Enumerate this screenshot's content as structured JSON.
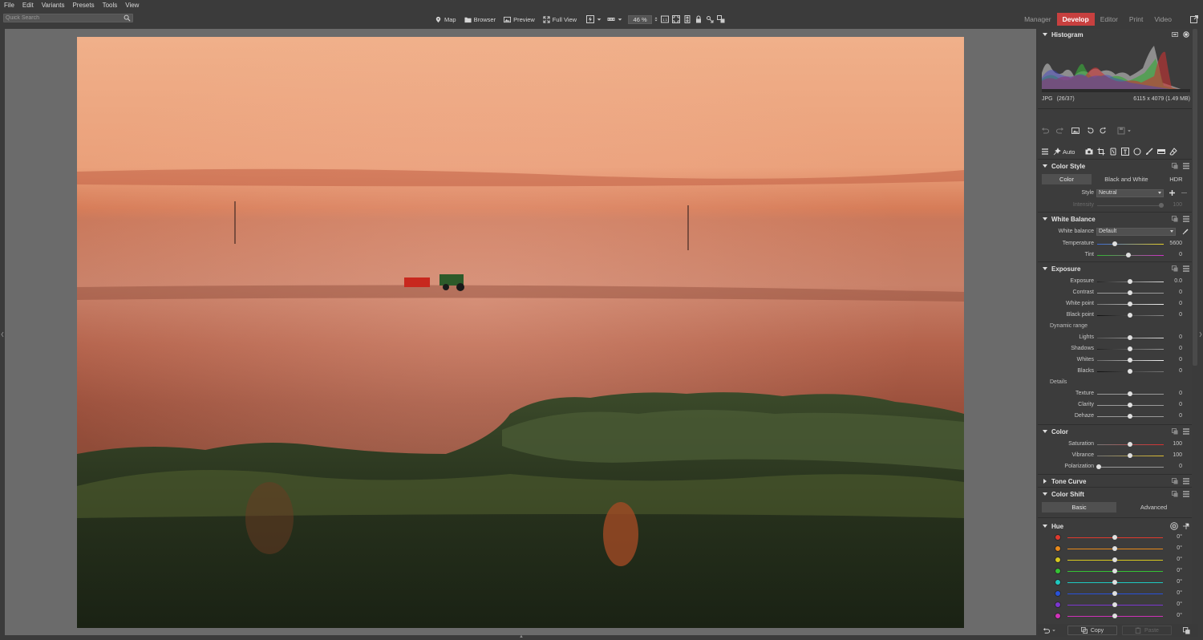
{
  "menu": [
    "File",
    "Edit",
    "Variants",
    "Presets",
    "Tools",
    "View"
  ],
  "search": {
    "placeholder": "Quick Search",
    "icon": "search-icon"
  },
  "toolbar": {
    "map": "Map",
    "browser": "Browser",
    "preview": "Preview",
    "full_view": "Full View",
    "zoom": "46 %"
  },
  "modes": {
    "manager": "Manager",
    "develop": "Develop",
    "editor": "Editor",
    "print": "Print",
    "video": "Video",
    "active": "Develop"
  },
  "histogram": {
    "title": "Histogram",
    "format": "JPG",
    "index": "(26/37)",
    "dims": "6115 x 4079 (1.49 MB)"
  },
  "tools": {
    "auto": "Auto"
  },
  "color_style": {
    "title": "Color Style",
    "tabs": [
      "Color",
      "Black and White",
      "HDR"
    ],
    "active_tab": "Color",
    "style_label": "Style",
    "style_value": "Neutral",
    "intensity_label": "Intensity",
    "intensity_value": "100"
  },
  "white_balance": {
    "title": "White Balance",
    "wb_label": "White balance",
    "wb_value": "Default",
    "temp_label": "Temperature",
    "temp_value": "5600",
    "tint_label": "Tint",
    "tint_value": "0"
  },
  "exposure": {
    "title": "Exposure",
    "rows": [
      {
        "label": "Exposure",
        "value": "0.0"
      },
      {
        "label": "Contrast",
        "value": "0"
      },
      {
        "label": "White point",
        "value": "0"
      },
      {
        "label": "Black point",
        "value": "0"
      }
    ],
    "dynamic_label": "Dynamic range",
    "dynamic": [
      {
        "label": "Lights",
        "value": "0"
      },
      {
        "label": "Shadows",
        "value": "0"
      },
      {
        "label": "Whites",
        "value": "0"
      },
      {
        "label": "Blacks",
        "value": "0"
      }
    ],
    "details_label": "Details",
    "details": [
      {
        "label": "Texture",
        "value": "0"
      },
      {
        "label": "Clarity",
        "value": "0"
      },
      {
        "label": "Dehaze",
        "value": "0"
      }
    ]
  },
  "color": {
    "title": "Color",
    "rows": [
      {
        "label": "Saturation",
        "value": "100"
      },
      {
        "label": "Vibrance",
        "value": "100"
      },
      {
        "label": "Polarization",
        "value": "0"
      }
    ]
  },
  "tone_curve": {
    "title": "Tone Curve"
  },
  "color_shift": {
    "title": "Color Shift",
    "tabs": [
      "Basic",
      "Advanced"
    ],
    "active_tab": "Basic",
    "hue_title": "Hue",
    "hue_rows": [
      {
        "color": "#e03a2e",
        "value": "0°"
      },
      {
        "color": "#e88a1a",
        "value": "0°"
      },
      {
        "color": "#d8c81e",
        "value": "0°"
      },
      {
        "color": "#34c234",
        "value": "0°"
      },
      {
        "color": "#1ec8c0",
        "value": "0°"
      },
      {
        "color": "#2852d8",
        "value": "0°"
      },
      {
        "color": "#7c36d0",
        "value": "0°"
      },
      {
        "color": "#d032b8",
        "value": "0°"
      }
    ]
  },
  "footer": {
    "copy": "Copy",
    "paste": "Paste"
  }
}
